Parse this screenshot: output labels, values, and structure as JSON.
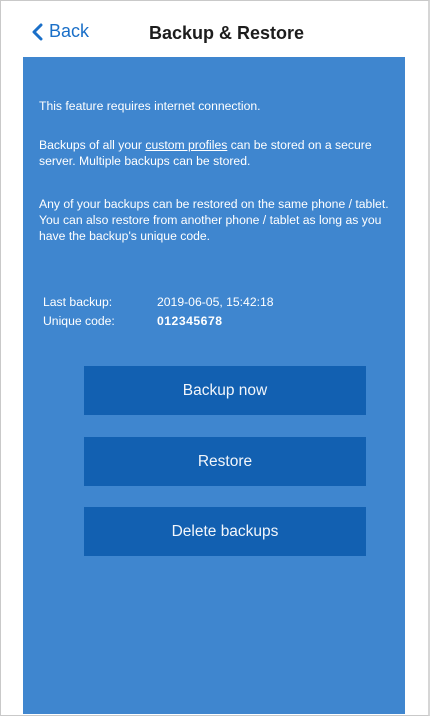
{
  "header": {
    "back_label": "Back",
    "title": "Backup & Restore"
  },
  "content": {
    "para1": "This feature requires internet connection.",
    "para2_before_link": "Backups of all your ",
    "para2_link": "custom profiles",
    "para2_after_link": " can be stored on a secure server. Multiple backups can be stored.",
    "para3": "Any of your backups can be restored on the same phone / tablet. You can also restore from another phone / tablet as long as you have the backup's unique code."
  },
  "info": {
    "last_backup_label": "Last backup:",
    "last_backup_value": "2019-06-05, 15:42:18",
    "unique_code_label": "Unique code:",
    "unique_code_value": "012345678"
  },
  "buttons": {
    "backup_now": "Backup now",
    "restore": "Restore",
    "delete_backups": "Delete backups"
  },
  "colors": {
    "background": "#3f86cf",
    "button": "#1260b1",
    "accent": "#1a6fc8"
  }
}
